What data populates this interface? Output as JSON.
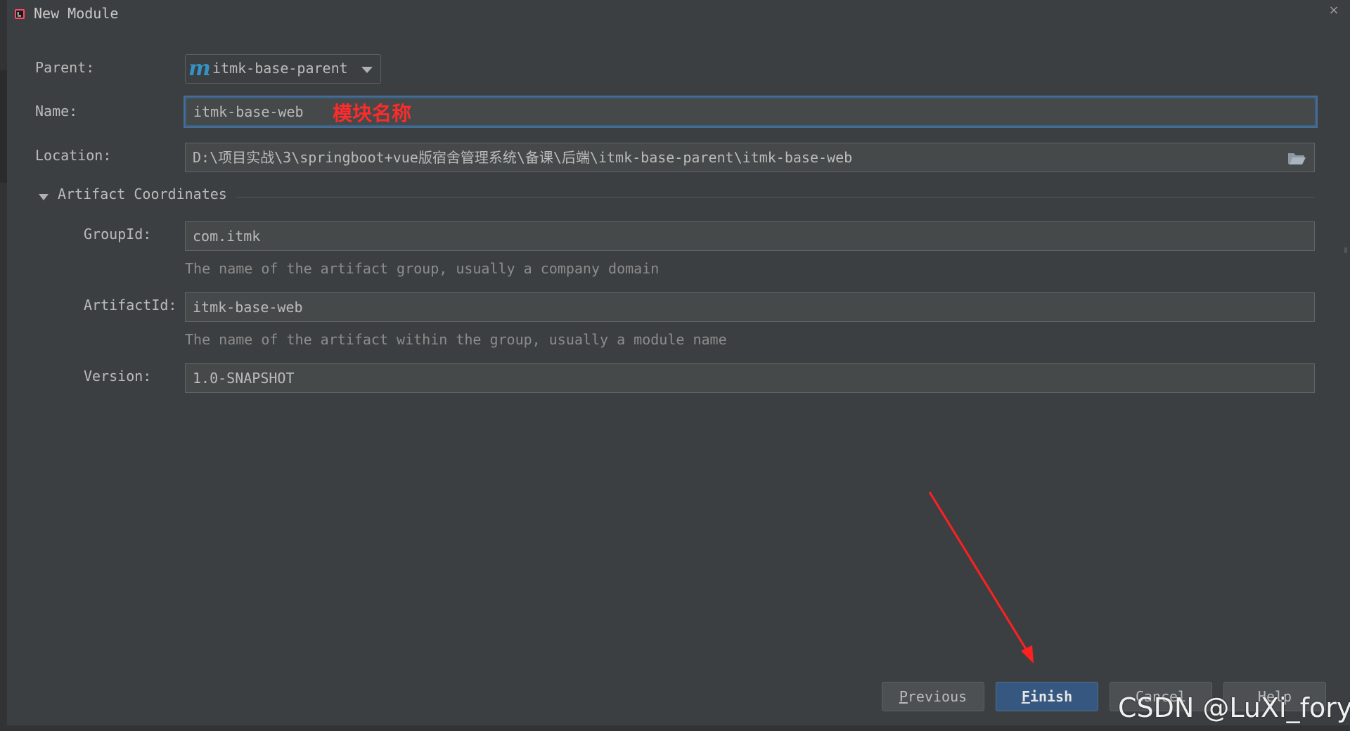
{
  "window": {
    "title": "New Module",
    "close_glyph": "×"
  },
  "form": {
    "parent_label": "Parent:",
    "parent_value": "itmk-base-parent",
    "parent_icon": "m",
    "name_label": "Name:",
    "name_value": "itmk-base-web",
    "name_annotation": "模块名称",
    "location_label": "Location:",
    "location_value": "D:\\项目实战\\3\\springboot+vue版宿舍管理系统\\备课\\后端\\itmk-base-parent\\itmk-base-web"
  },
  "artifact": {
    "section_title": "Artifact Coordinates",
    "groupid_label": "GroupId:",
    "groupid_value": "com.itmk",
    "groupid_hint": "The name of the artifact group, usually a company domain",
    "artifactid_label": "ArtifactId:",
    "artifactid_value": "itmk-base-web",
    "artifactid_hint": "The name of the artifact within the group, usually a module name",
    "version_label": "Version:",
    "version_value": "1.0-SNAPSHOT"
  },
  "buttons": {
    "previous_mnemonic": "P",
    "previous_rest": "revious",
    "finish_mnemonic": "F",
    "finish_rest": "inish",
    "cancel": "Cancel",
    "help": "Help"
  },
  "watermark": "CSDN @LuXi_foryou",
  "colors": {
    "background": "#3c3f41",
    "field_background": "#45494a",
    "focus_border": "#466d94",
    "default_button": "#365880",
    "annotation_red": "#ff2a2a",
    "arrow_red": "#ff2020"
  },
  "icons": {
    "app": "intellij-icon",
    "folder": "folder-open-icon",
    "dropdown": "chevron-down-icon",
    "section_toggle": "triangle-down-icon"
  }
}
